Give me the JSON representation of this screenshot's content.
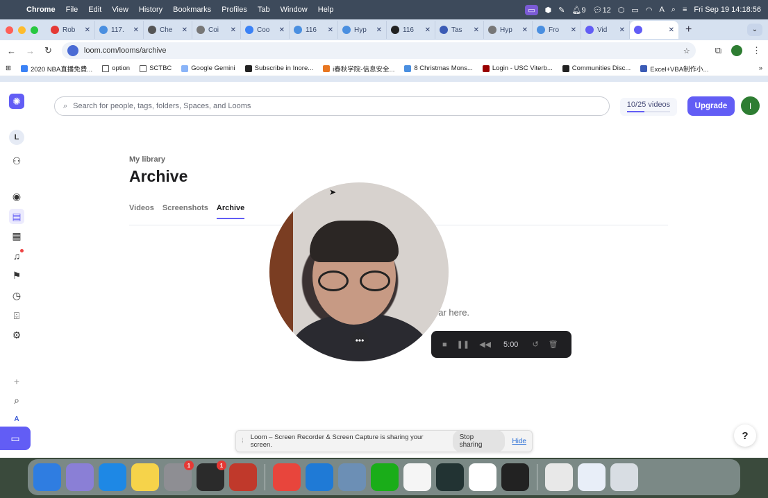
{
  "menubar": {
    "app": "Chrome",
    "items": [
      "File",
      "Edit",
      "View",
      "History",
      "Bookmarks",
      "Profiles",
      "Tab",
      "Window",
      "Help"
    ],
    "status": {
      "bell_count": "9",
      "wechat_count": "12",
      "datetime": "Fri Sep 19  14:18:56"
    }
  },
  "tabs": [
    {
      "title": "Rob",
      "color": "#e53935"
    },
    {
      "title": "117.",
      "color": "#4a8fe0"
    },
    {
      "title": "Che",
      "color": "#555555"
    },
    {
      "title": "Coi",
      "color": "#777777"
    },
    {
      "title": "Coo",
      "color": "#3b82f6"
    },
    {
      "title": "116",
      "color": "#4a8fe0"
    },
    {
      "title": "Hyp",
      "color": "#4a8fe0"
    },
    {
      "title": "116",
      "color": "#222222"
    },
    {
      "title": "Tas",
      "color": "#3b5bb5"
    },
    {
      "title": "Hyp",
      "color": "#777777"
    },
    {
      "title": "Fro",
      "color": "#4a8fe0"
    },
    {
      "title": "Vid",
      "color": "#625df5"
    },
    {
      "title": "",
      "color": "#625df5",
      "active": true
    }
  ],
  "toolbar": {
    "url": "loom.com/looms/archive"
  },
  "bookmarks": [
    {
      "label": "2020 NBA直播免費...",
      "color": "#3b82f6"
    },
    {
      "label": "option",
      "folder": true
    },
    {
      "label": "SCTBC",
      "folder": true
    },
    {
      "label": "Google Gemini",
      "color": "#8ab4f8"
    },
    {
      "label": "Subscribe in Inore...",
      "color": "#222222"
    },
    {
      "label": "i春秋学院-信息安全...",
      "color": "#e87722"
    },
    {
      "label": "8 Christmas Mons...",
      "color": "#4a8fe0"
    },
    {
      "label": "Login - USC Viterb...",
      "color": "#990000"
    },
    {
      "label": "Communities Disc...",
      "color": "#222222"
    },
    {
      "label": "Excel+VBA制作小...",
      "color": "#3b5bb5"
    }
  ],
  "loom": {
    "search_placeholder": "Search for people, tags, folders, Spaces, and Looms",
    "usage_label": "10/25 videos",
    "usage_fraction": 0.4,
    "upgrade_label": "Upgrade",
    "user_initial": "I",
    "rail_avatar": "L",
    "breadcrumb": "My library",
    "title": "Archive",
    "tabs": [
      "Videos",
      "Screenshots",
      "Archive"
    ],
    "empty_title_partial": "re",
    "empty_sub_partial": "ear here.",
    "recording": {
      "time": "5:00"
    },
    "share_bar": {
      "message": "Loom – Screen Recorder & Screen Capture is sharing your screen.",
      "stop_label": "Stop sharing",
      "hide_label": "Hide"
    },
    "help_label": "?"
  },
  "dock": [
    {
      "name": "finder-icon",
      "color": "#2f7de1"
    },
    {
      "name": "launchpad-icon",
      "color": "#8a7fd6"
    },
    {
      "name": "safari-icon",
      "color": "#1e88e5"
    },
    {
      "name": "notes-icon",
      "color": "#f6d34a"
    },
    {
      "name": "system-settings-icon",
      "color": "#8e8e93",
      "badge": "1"
    },
    {
      "name": "terminal-icon",
      "color": "#2b2b2b",
      "badge": "1"
    },
    {
      "name": "iphone-mirroring-icon",
      "color": "#c0392b"
    },
    {
      "name": "chrome-icon",
      "color": "#e8453c"
    },
    {
      "name": "vscode-icon",
      "color": "#1f7ad6"
    },
    {
      "name": "preview-icon",
      "color": "#6c8fb5"
    },
    {
      "name": "wechat-icon",
      "color": "#1aad19"
    },
    {
      "name": "qq-icon",
      "color": "#f5f5f5"
    },
    {
      "name": "activity-monitor-icon",
      "color": "#233"
    },
    {
      "name": "panda-icon",
      "color": "#ffffff"
    },
    {
      "name": "box-icon",
      "color": "#222222"
    },
    {
      "name": "document-icon",
      "color": "#e8e8e8"
    },
    {
      "name": "window-thumbnail-icon",
      "color": "#e8eef8"
    },
    {
      "name": "trash-icon",
      "color": "#d8dde3"
    }
  ]
}
